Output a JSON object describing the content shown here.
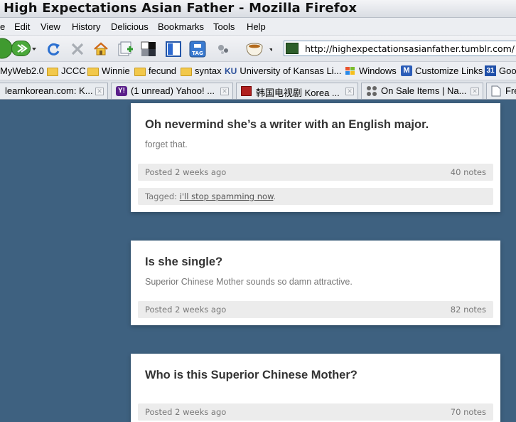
{
  "window": {
    "title": "High Expectations Asian Father - Mozilla Firefox"
  },
  "menu": [
    "e",
    "Edit",
    "View",
    "History",
    "Delicious",
    "Bookmarks",
    "Tools",
    "Help"
  ],
  "address": {
    "url": "http://highexpectationsasianfather.tumblr.com/"
  },
  "bookmarks": [
    "MyWeb2.0",
    "JCCC",
    "Winnie",
    "fecund",
    "syntax",
    "University of Kansas Li...",
    "Windows",
    "Customize Links",
    "Goo"
  ],
  "tabs": [
    "learnkorean.com: K...",
    "(1 unread) Yahoo! ...",
    "韩国电视剧 Korea ...",
    "On Sale Items | Na...",
    "Fre"
  ],
  "posts": [
    {
      "title": "Oh nevermind she’s a writer with an English major.",
      "body": "forget that.",
      "posted": "Posted 2 weeks ago",
      "notes": "40 notes",
      "tagged_label": "Tagged: ",
      "tag": "i'll stop spamming now",
      "tag_suffix": "."
    },
    {
      "title": "Is she single?",
      "body": "Superior Chinese Mother sounds so damn attractive.",
      "posted": "Posted 2 weeks ago",
      "notes": "82 notes"
    },
    {
      "title": "Who is this Superior Chinese Mother?",
      "posted": "Posted 2 weeks ago",
      "notes": "70 notes"
    }
  ],
  "colors": {
    "page_bg": "#3e6180",
    "card_bg": "#ffffff",
    "meta_bg": "#ececec"
  }
}
